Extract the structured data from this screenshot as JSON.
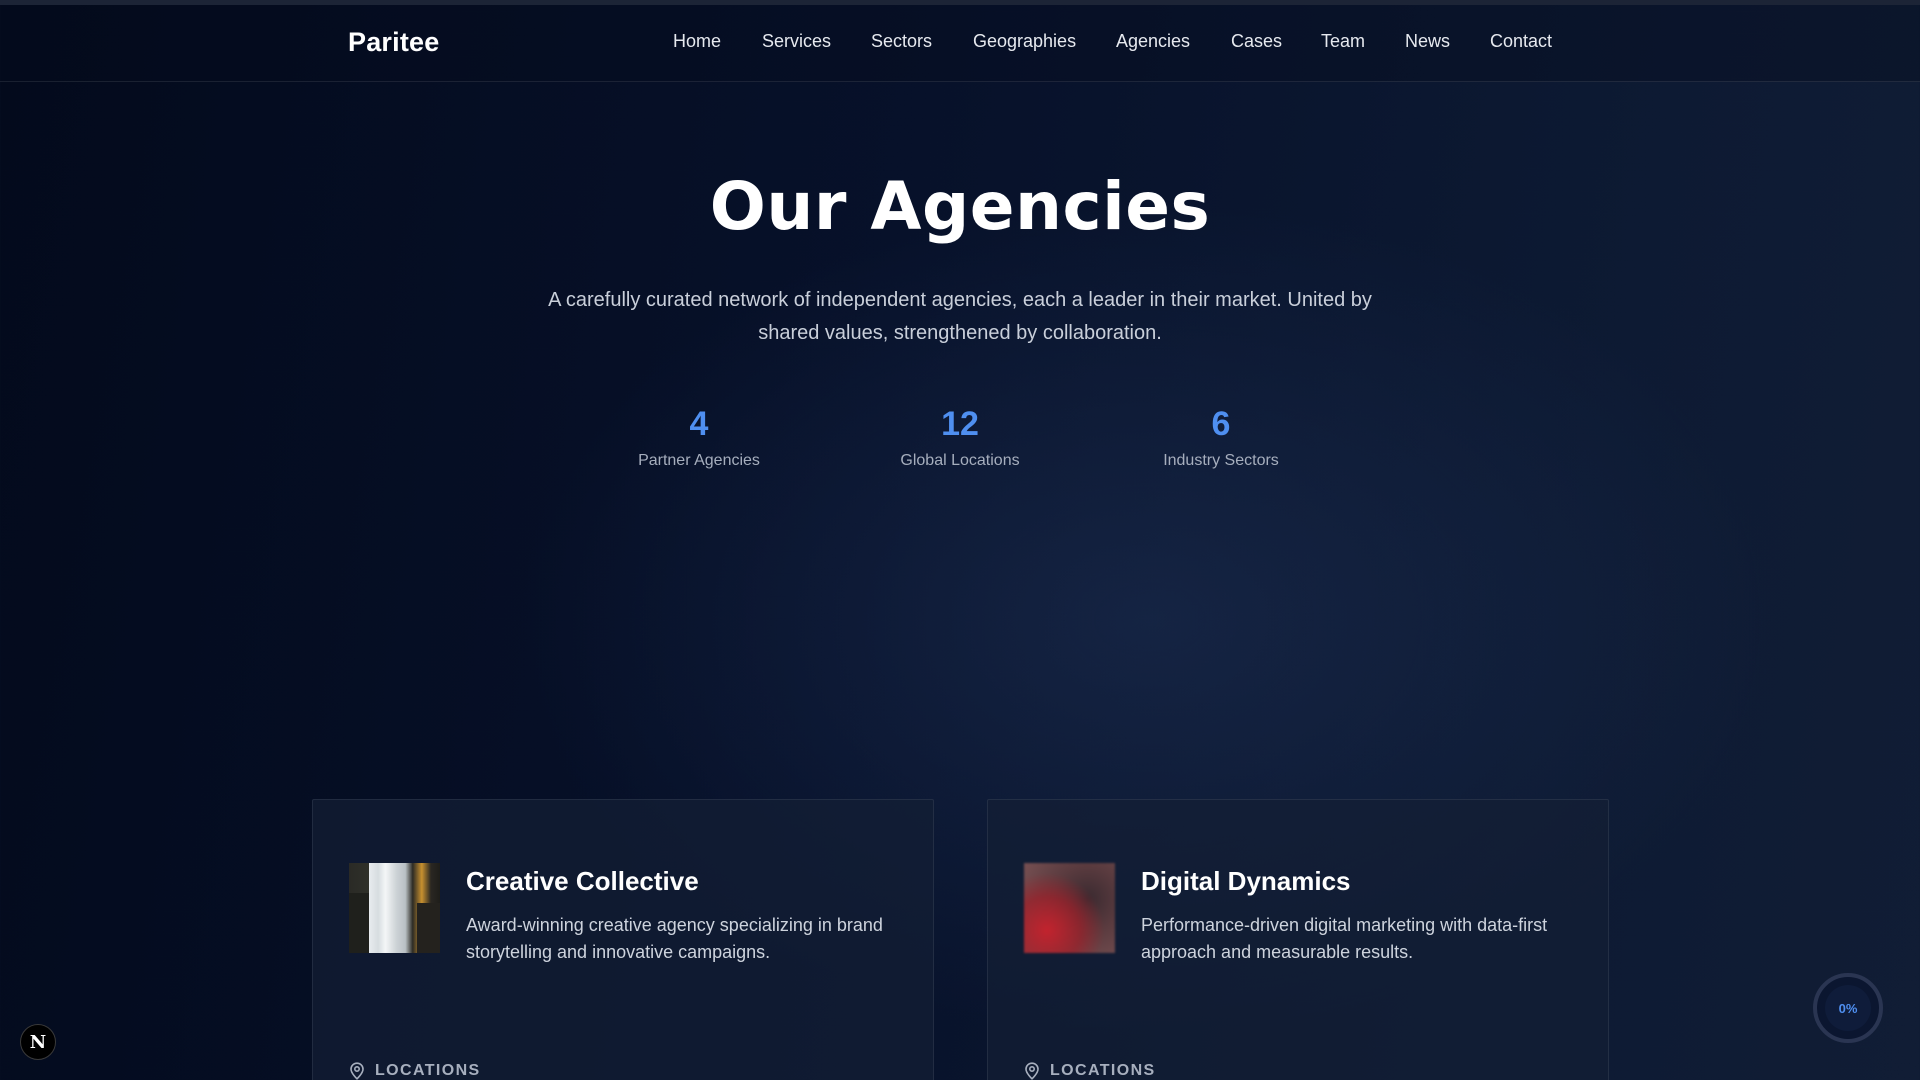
{
  "header": {
    "logo": "Paritee",
    "nav": [
      {
        "label": "Home"
      },
      {
        "label": "Services"
      },
      {
        "label": "Sectors"
      },
      {
        "label": "Geographies"
      },
      {
        "label": "Agencies"
      },
      {
        "label": "Cases"
      },
      {
        "label": "Team"
      },
      {
        "label": "News"
      },
      {
        "label": "Contact"
      }
    ]
  },
  "hero": {
    "title": "Our Agencies",
    "subtitle": "A carefully curated network of independent agencies, each a leader in their market. United by shared values, strengthened by collaboration."
  },
  "stats": [
    {
      "value": "4",
      "label": "Partner Agencies"
    },
    {
      "value": "12",
      "label": "Global Locations"
    },
    {
      "value": "6",
      "label": "Industry Sectors"
    }
  ],
  "agencies": [
    {
      "name": "Creative Collective",
      "description": "Award-winning creative agency specializing in brand storytelling and innovative campaigns.",
      "locations_label": "LOCATIONS",
      "icon": "map-pin-icon"
    },
    {
      "name": "Digital Dynamics",
      "description": "Performance-driven digital marketing with data-first approach and measurable results.",
      "locations_label": "LOCATIONS",
      "icon": "map-pin-icon"
    }
  ],
  "widgets": {
    "dev_badge": "N",
    "scroll_progress": "0%",
    "scroll_progress_value": 0
  },
  "colors": {
    "accent": "#4f8ff0",
    "background": "#07112a",
    "card": "#141e34"
  }
}
